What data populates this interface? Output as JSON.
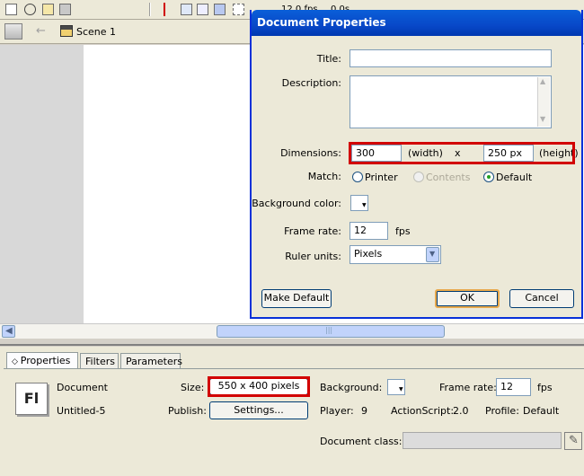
{
  "timeline": {
    "fps_partial": "12.0 fps",
    "time_partial": "0.0s",
    "scene_label": "Scene 1"
  },
  "dialog": {
    "title": "Document Properties",
    "title_label": "Title:",
    "title_value": "",
    "description_label": "Description:",
    "description_value": "",
    "dimensions_label": "Dimensions:",
    "width_value": "300",
    "width_unit": "(width)",
    "x_label": "x",
    "height_value": "250 px",
    "height_unit": "(height)",
    "match_label": "Match:",
    "match_options": [
      "Printer",
      "Contents",
      "Default"
    ],
    "match_selected": "Default",
    "background_color_label": "Background color:",
    "frame_rate_label": "Frame rate:",
    "frame_rate_value": "12",
    "fps_label": "fps",
    "ruler_units_label": "Ruler units:",
    "ruler_units_value": "Pixels",
    "make_default_label": "Make Default",
    "ok_label": "OK",
    "cancel_label": "Cancel"
  },
  "properties_panel": {
    "tabs": [
      "Properties",
      "Filters",
      "Parameters"
    ],
    "active_tab": "Properties",
    "logo_text": "Fl",
    "doc_type": "Document",
    "doc_name": "Untitled-5",
    "size_label": "Size:",
    "size_value": "550 x 400 pixels",
    "publish_label": "Publish:",
    "settings_label": "Settings...",
    "background_label": "Background:",
    "frame_rate_label": "Frame rate:",
    "frame_rate_value": "12",
    "fps_label": "fps",
    "player_label": "Player:",
    "player_value": "9",
    "actionscript_label": "ActionScript:",
    "actionscript_value": "2.0",
    "profile_label": "Profile:",
    "profile_value": "Default",
    "document_class_label": "Document class:",
    "document_class_value": ""
  },
  "colors": {
    "highlight": "#d20000",
    "title_bar": "#0848c8",
    "radio_dot": "#21a121"
  }
}
